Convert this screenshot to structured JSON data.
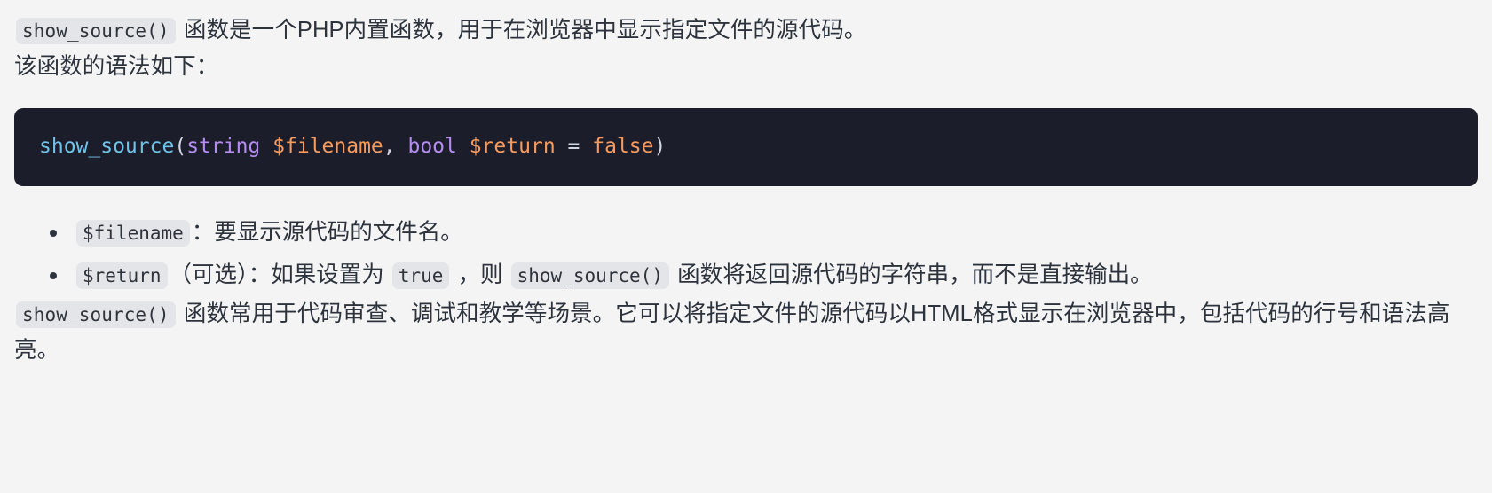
{
  "page": {
    "background_color": "#f4f4f4",
    "text_color": "#2d333d",
    "inline_code_bg": "#e3e5e8"
  },
  "intro": {
    "code": "show_source()",
    "text": " 函数是一个PHP内置函数，用于在浏览器中显示指定文件的源代码。"
  },
  "syntax_lead": {
    "text": "该函数的语法如下："
  },
  "code_block": {
    "background_color": "#1b1d2a",
    "language": "php",
    "raw": "show_source(string $filename, bool $return = false)",
    "tokens": [
      {
        "text": "show_source",
        "type": "function",
        "color": "#6fc3e8"
      },
      {
        "text": "(",
        "type": "punctuation",
        "color": "#cfd5e1"
      },
      {
        "text": "string",
        "type": "type",
        "color": "#b78cf2"
      },
      {
        "text": " ",
        "type": "space",
        "color": "#cfd5e1"
      },
      {
        "text": "$filename",
        "type": "variable",
        "color": "#f79a5c"
      },
      {
        "text": ",",
        "type": "punctuation",
        "color": "#cfd5e1"
      },
      {
        "text": " ",
        "type": "space",
        "color": "#cfd5e1"
      },
      {
        "text": "bool",
        "type": "type",
        "color": "#b78cf2"
      },
      {
        "text": " ",
        "type": "space",
        "color": "#cfd5e1"
      },
      {
        "text": "$return",
        "type": "variable",
        "color": "#f79a5c"
      },
      {
        "text": " ",
        "type": "space",
        "color": "#cfd5e1"
      },
      {
        "text": "=",
        "type": "operator",
        "color": "#cfd5e1"
      },
      {
        "text": " ",
        "type": "space",
        "color": "#cfd5e1"
      },
      {
        "text": "false",
        "type": "boolean",
        "color": "#f79a5c"
      },
      {
        "text": ")",
        "type": "punctuation",
        "color": "#cfd5e1"
      }
    ]
  },
  "params": [
    {
      "code": "$filename",
      "text": "：要显示源代码的文件名。"
    },
    {
      "code": "$return",
      "text_1": "（可选）：如果设置为 ",
      "code_2": "true",
      "text_2": " ，则 ",
      "code_3": "show_source()",
      "text_3": " 函数将返回源代码的字符串，而不是直接输出。"
    }
  ],
  "outro": {
    "code": "show_source()",
    "text": " 函数常用于代码审查、调试和教学等场景。它可以将指定文件的源代码以HTML格式显示在浏览器中，包括代码的行号和语法高亮。"
  }
}
